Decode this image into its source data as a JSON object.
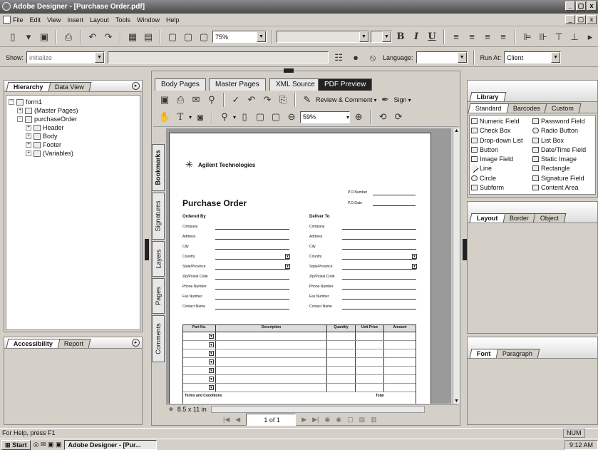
{
  "window": {
    "title": "Adobe Designer - [Purchase Order.pdf]",
    "min": "_",
    "max": "▢",
    "close": "x"
  },
  "menu": [
    "File",
    "Edit",
    "View",
    "Insert",
    "Layout",
    "Tools",
    "Window",
    "Help"
  ],
  "toolbar": {
    "zoom": "75%",
    "font_combo": "",
    "size_combo": "",
    "bold": "B",
    "italic": "I",
    "underline": "U"
  },
  "toolbar2": {
    "show_label": "Show:",
    "show_value": "initialize",
    "language_label": "Language:",
    "language_value": "",
    "runat_label": "Run At:",
    "runat_value": "Client"
  },
  "left_top_panel": {
    "tabs": [
      "Hierarchy",
      "Data View"
    ],
    "tree": [
      {
        "label": "form1",
        "indent": 0,
        "sign": "−"
      },
      {
        "label": "(Master Pages)",
        "indent": 1,
        "sign": "+"
      },
      {
        "label": "purchaseOrder",
        "indent": 1,
        "sign": "−"
      },
      {
        "label": "Header",
        "indent": 2,
        "sign": "+"
      },
      {
        "label": "Body",
        "indent": 2,
        "sign": "+"
      },
      {
        "label": "Footer",
        "indent": 2,
        "sign": "+"
      },
      {
        "label": "(Variables)",
        "indent": 2,
        "sign": "+"
      }
    ]
  },
  "left_bottom_panel": {
    "tabs": [
      "Accessibility",
      "Report"
    ]
  },
  "doc_tabs": [
    "Body Pages",
    "Master Pages",
    "XML Source",
    "PDF Preview"
  ],
  "pdf_toolbar": {
    "review": "Review & Comment",
    "sign": "Sign",
    "zoom": "59%",
    "text_tool": "T"
  },
  "side_tabs": [
    "Bookmarks",
    "Signatures",
    "Layers",
    "Pages",
    "Comments"
  ],
  "page_size": "8.5 x 11 in",
  "page_nav": "1 of 1",
  "form": {
    "company": "Agilent Technologies",
    "title": "Purchase Order",
    "po_number": "P.O.Number",
    "po_date": "P.O.Date",
    "ordered_by": "Ordered By",
    "deliver_to": "Deliver To",
    "fields": [
      "Company",
      "Address",
      "City",
      "Country",
      "State/Province",
      "Zip/Postal Code",
      "Phone Number",
      "Fax Number",
      "Contact Name"
    ],
    "table_headers": [
      "Part No.",
      "Description",
      "Quantity",
      "Unit Price",
      "Amount"
    ],
    "terms": "Terms and Conditions",
    "total": "Total"
  },
  "library": {
    "title": "Library",
    "tabs": [
      "Standard",
      "Barcodes",
      "Custom"
    ],
    "items": [
      "Numeric Field",
      "Password Field",
      "Check Box",
      "Radio Button",
      "Drop-down List",
      "List Box",
      "Button",
      "Date/Time Field",
      "Image Field",
      "Static Image",
      "Line",
      "Rectangle",
      "Circle",
      "Signature Field",
      "Subform",
      "Content Area"
    ]
  },
  "layout_panel": {
    "tabs": [
      "Layout",
      "Border",
      "Object"
    ]
  },
  "font_panel": {
    "tabs": [
      "Font",
      "Paragraph"
    ]
  },
  "status": {
    "help": "For Help, press F1",
    "num": "NUM"
  },
  "taskbar": {
    "start": "Start",
    "task": "Adobe Designer - [Pur...",
    "clock": "9:12 AM"
  }
}
